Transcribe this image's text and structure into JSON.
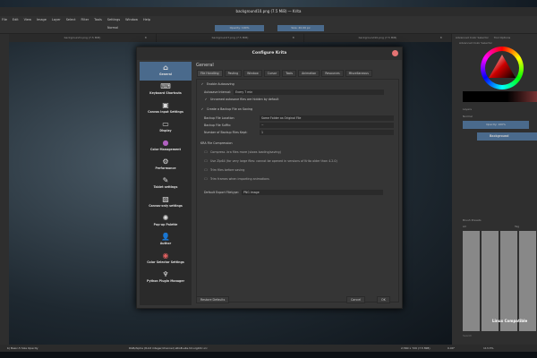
{
  "window": {
    "title": "background10.png (7.5 MiB) — Krita"
  },
  "menu": [
    "File",
    "Edit",
    "View",
    "Image",
    "Layer",
    "Select",
    "Filter",
    "Tools",
    "Settings",
    "Window",
    "Help"
  ],
  "toolbar": {
    "blend_mode": "Normal",
    "opacity": "Opacity: 100%",
    "size": "Size: 40.00 px"
  },
  "doc_tabs": [
    {
      "label": "background1.png (7.5 MiB)"
    },
    {
      "label": "background7.png (7.5 MiB)"
    },
    {
      "label": "background10.png (7.5 MiB)"
    }
  ],
  "dock": {
    "tabs": [
      "Advanced Color Selector",
      "Tool Options"
    ],
    "color_title": "Advanced Color Selector",
    "layers_title": "Layers",
    "layer_blend": "Normal",
    "layer_opacity": "Opacity: 100%",
    "layer_name": "Background",
    "brush_title": "Brush Presets",
    "brush_filter": "All",
    "brush_tag": "Tag",
    "search_placeholder": "Search"
  },
  "status": {
    "brush": "b) Basic-5 Size Opacity",
    "color": "RGB/Alpha (8-bit integer/channel)  sRGB-elle-V2-srgbtrc.icc",
    "dims": "2,560 x 720 (7.5 MiB)",
    "rotation": "0.00°",
    "zoom": "113.3%"
  },
  "watermark": "Linux Compatible",
  "dialog": {
    "title": "Configure Krita",
    "sidebar": [
      "General",
      "Keyboard Shortcuts",
      "Canvas Input Settings",
      "Display",
      "Color Management",
      "Performance",
      "Tablet settings",
      "Canvas-only settings",
      "Pop-up Palette",
      "Author",
      "Color Selector Settings",
      "Python Plugin Manager"
    ],
    "heading": "General",
    "tabs": [
      "File Handling",
      "Pasting",
      "Window",
      "Cursor",
      "Tools",
      "Animation",
      "Resources",
      "Miscellaneous"
    ],
    "enable_autosave": "Enable Autosaving",
    "autosave_interval_label": "Autosave Interval:",
    "autosave_interval": "Every 7 min",
    "unnamed_hidden": "Unnamed autosave files are hidden by default",
    "create_backup": "Create a Backup File on Saving",
    "backup_location_label": "Backup File Location",
    "backup_location": "Same Folder as Original File",
    "backup_suffix_label": "Backup File Suffix:",
    "backup_suffix": "~",
    "backup_count_label": "Number of Backup Files Kept:",
    "backup_count": "1",
    "kra_heading": "KRA File Compression",
    "compress": "Compress .kra files more (slows loading/saving)",
    "zip64": "Use Zip64 (for very large files: cannot be opened in versions of Krita older than 4.2.0)",
    "trim_files": "Trim files before saving",
    "trim_frames": "Trim frames when importing animations",
    "export_label": "Default Export Filetype:",
    "export_value": "PNG image",
    "restore": "Restore Defaults",
    "cancel": "Cancel",
    "ok": "OK"
  }
}
